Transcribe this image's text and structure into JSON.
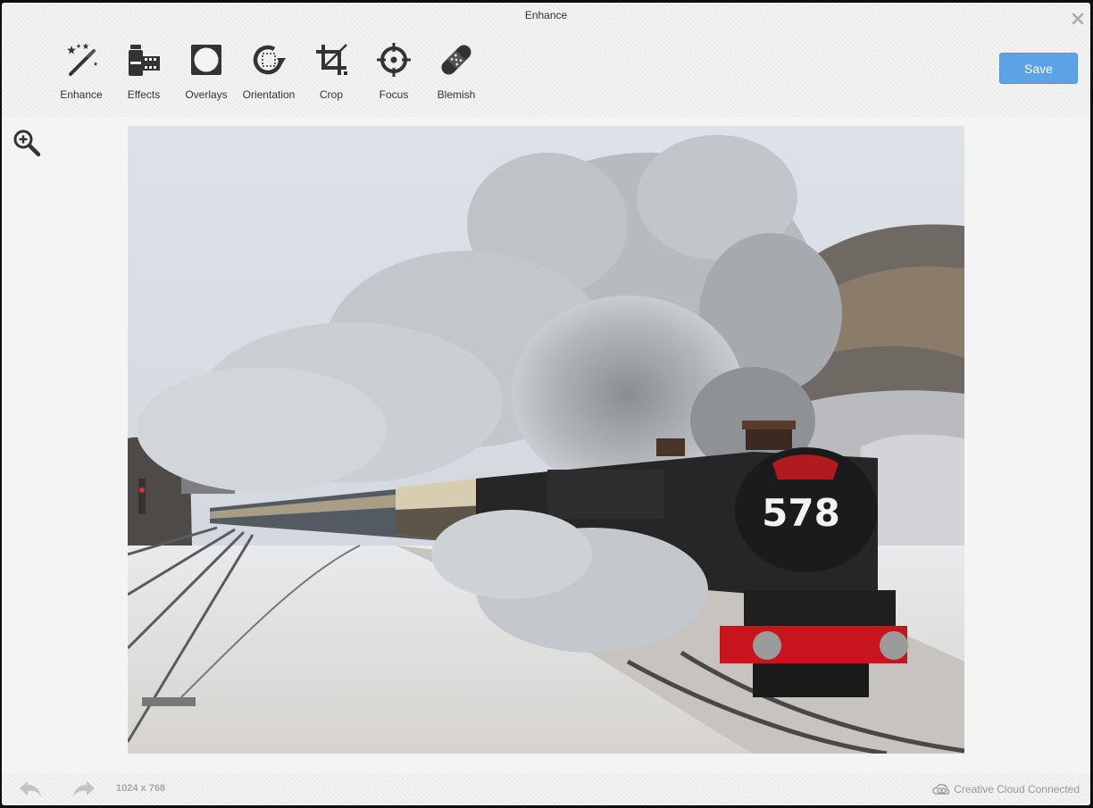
{
  "window": {
    "title": "Enhance"
  },
  "toolbar": {
    "tools": [
      {
        "label": "Enhance",
        "icon": "magic-wand-icon"
      },
      {
        "label": "Effects",
        "icon": "film-icon"
      },
      {
        "label": "Overlays",
        "icon": "overlay-frame-icon"
      },
      {
        "label": "Orientation",
        "icon": "rotate-icon"
      },
      {
        "label": "Crop",
        "icon": "crop-icon"
      },
      {
        "label": "Focus",
        "icon": "focus-target-icon"
      },
      {
        "label": "Blemish",
        "icon": "bandage-icon"
      }
    ],
    "save_label": "Save"
  },
  "photo": {
    "subject": "steam locomotive in snow",
    "engine_number": "578"
  },
  "footer": {
    "dimensions": "1024 x 768",
    "cloud_status": "Creative Cloud Connected"
  },
  "colors": {
    "accent": "#5ba2e6",
    "icon": "#333333",
    "muted_text": "#999999",
    "buffer_red": "#c8141c"
  }
}
